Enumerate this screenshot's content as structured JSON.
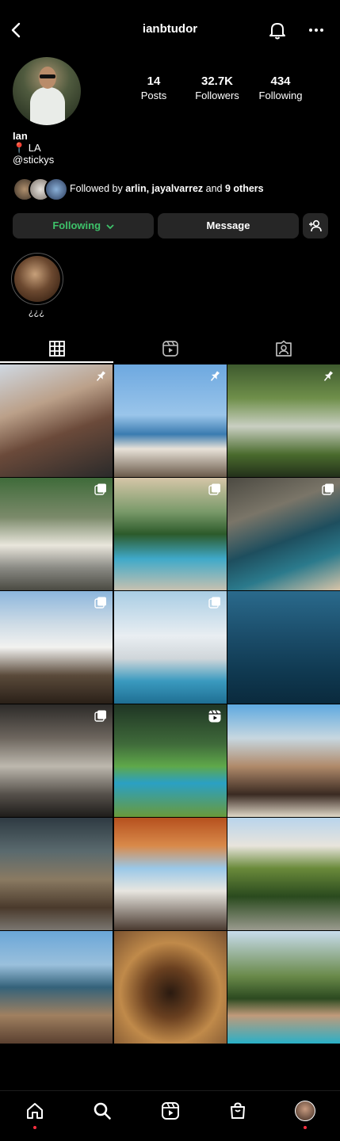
{
  "header": {
    "username": "ianbtudor"
  },
  "profile": {
    "stats": [
      {
        "number": "14",
        "label": "Posts"
      },
      {
        "number": "32.7K",
        "label": "Followers"
      },
      {
        "number": "434",
        "label": "Following"
      }
    ],
    "name": "Ian",
    "location": "📍 LA",
    "handle": "@stickys",
    "followed_by": {
      "prefix": "Followed by ",
      "names": "arlin, jayalvarrez",
      "middle": " and ",
      "others": "9 others"
    }
  },
  "buttons": {
    "following": "Following",
    "message": "Message"
  },
  "highlight": {
    "label": "¿¿¿"
  },
  "colors": {
    "following_green": "#3ec26a",
    "notification_dot": "#ff3040",
    "button_bg": "#262626"
  },
  "grid": {
    "tiles": [
      {
        "badge": "pin",
        "bg": "linear-gradient(160deg,#cfd8e2 0%,#bba089 35%,#6b4a3a 60%,#2a2a2a 100%)"
      },
      {
        "badge": "pin",
        "bg": "linear-gradient(180deg,#6da8e0 0%,#9ac5ea 45%,#3a7bb0 62%,#e8e2d8 75%,#6a5a4a 100%)"
      },
      {
        "badge": "pin",
        "bg": "linear-gradient(180deg,#3e5a2e 0%,#6f8f4a 30%,#c9cfc2 55%,#4a6b2d 80%,#23301a 100%)"
      },
      {
        "badge": "multi",
        "bg": "linear-gradient(180deg,#3f6b3a 0%,#7b8a6a 35%,#e9e6dc 60%,#8a8a84 80%,#4a4a42 100%)"
      },
      {
        "badge": "multi",
        "bg": "linear-gradient(180deg,#d5c6a8 0%,#7a9a6a 30%,#2c5a2a 50%,#3fa9c9 72%,#c7c1b0 100%)"
      },
      {
        "badge": "multi",
        "bg": "linear-gradient(160deg,#4c4a42 0%,#7a7568 30%,#1e4e5e 55%,#2b7a8c 75%,#d8c4a8 100%)"
      },
      {
        "badge": "multi",
        "bg": "linear-gradient(180deg,#8cb6dc 0%,#cfdce6 30%,#f2f2f0 50%,#5a4a3a 75%,#2a2018 100%)"
      },
      {
        "badge": "multi",
        "bg": "linear-gradient(180deg,#a9cde4 0%,#e9eef2 40%,#d0d6da 60%,#3a9abf 80%,#1f6f93 100%)"
      },
      {
        "badge": "none",
        "bg": "linear-gradient(180deg,#2a6a8c 0%,#1b4d6a 40%,#103a52 70%,#0a2a3d 100%)"
      },
      {
        "badge": "multi",
        "bg": "linear-gradient(180deg,#2c2a28 0%,#6d665e 30%,#bdb8ae 55%,#55504a 80%,#1e1c1a 100%)"
      },
      {
        "badge": "reel",
        "bg": "linear-gradient(180deg,#1f3524 0%,#3f6a3a 35%,#5fa84a 55%,#2aa0c4 70%,#6a9a3a 100%)"
      },
      {
        "badge": "none",
        "bg": "linear-gradient(180deg,#5ea9e0 0%,#c7d7e0 30%,#b08a6a 55%,#3a2a22 80%,#e0d8c8 100%)"
      },
      {
        "badge": "none",
        "bg": "linear-gradient(180deg,#2e3a42 0%,#5a6a6e 30%,#8a7a62 55%,#4a3a2c 80%,#7a7670 100%)"
      },
      {
        "badge": "none",
        "bg": "linear-gradient(180deg,#b5501e 0%,#d98a4a 25%,#9ac8e8 45%,#e8e6e0 65%,#4a3a30 100%)"
      },
      {
        "badge": "none",
        "bg": "linear-gradient(180deg,#b8d4ec 0%,#e8e4dc 25%,#6a8a3a 45%,#2a4a1e 70%,#9a9a8e 100%)"
      },
      {
        "badge": "none",
        "bg": "linear-gradient(180deg,#6aa6d8 0%,#9ac0dc 30%,#34627a 50%,#a08060 75%,#5a4030 100%)"
      },
      {
        "badge": "none",
        "bg": "radial-gradient(circle at 50% 55%,#2a1a10 0%,#6a4020 30%,#c08a4a 60%,#7a5230 100%)"
      },
      {
        "badge": "none",
        "bg": "linear-gradient(180deg,#c8dcec 0%,#6a8a4a 40%,#2c4a20 60%,#c09a7a 75%,#2ab0c8 100%)"
      }
    ]
  }
}
